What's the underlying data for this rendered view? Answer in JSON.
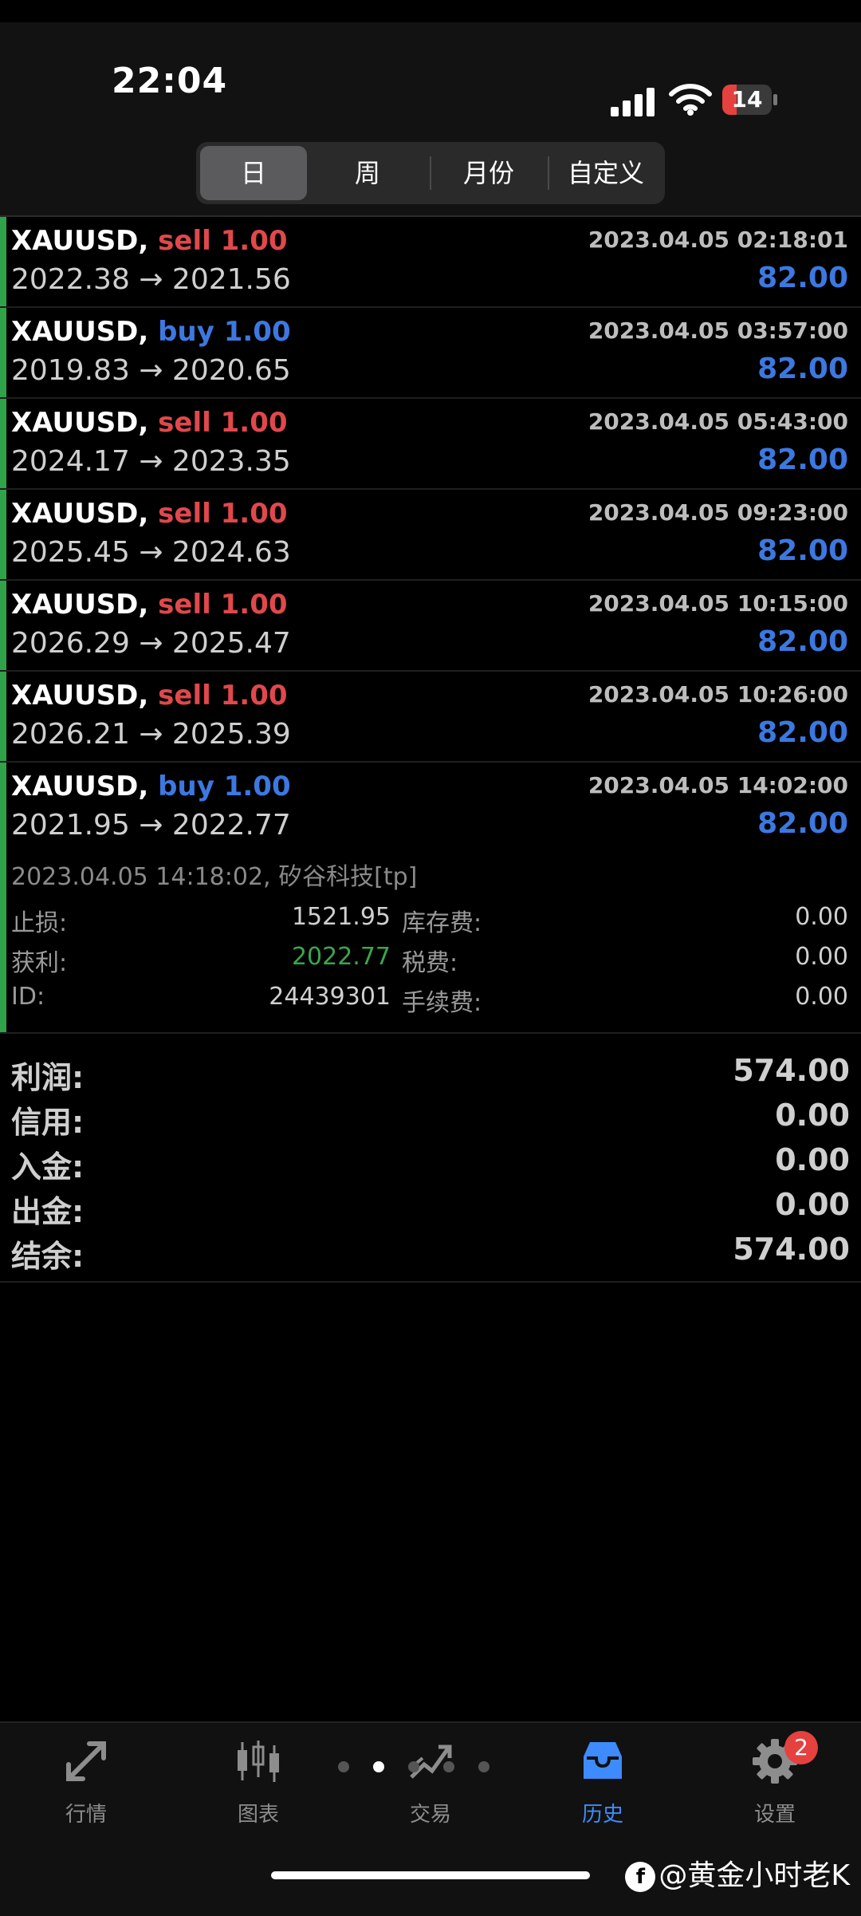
{
  "status_bar": {
    "time": "22:04",
    "battery": "14"
  },
  "period_tabs": [
    "日",
    "周",
    "月份",
    "自定义"
  ],
  "deals": [
    {
      "symbol": "XAUUSD,",
      "type": "sell",
      "volume": "1.00",
      "time": "2023.04.05 02:18:01",
      "prices": "2022.38 → 2021.56",
      "profit": "82.00"
    },
    {
      "symbol": "XAUUSD,",
      "type": "buy",
      "volume": "1.00",
      "time": "2023.04.05 03:57:00",
      "prices": "2019.83 → 2020.65",
      "profit": "82.00"
    },
    {
      "symbol": "XAUUSD,",
      "type": "sell",
      "volume": "1.00",
      "time": "2023.04.05 05:43:00",
      "prices": "2024.17 → 2023.35",
      "profit": "82.00"
    },
    {
      "symbol": "XAUUSD,",
      "type": "sell",
      "volume": "1.00",
      "time": "2023.04.05 09:23:00",
      "prices": "2025.45 → 2024.63",
      "profit": "82.00"
    },
    {
      "symbol": "XAUUSD,",
      "type": "sell",
      "volume": "1.00",
      "time": "2023.04.05 10:15:00",
      "prices": "2026.29 → 2025.47",
      "profit": "82.00"
    },
    {
      "symbol": "XAUUSD,",
      "type": "sell",
      "volume": "1.00",
      "time": "2023.04.05 10:26:00",
      "prices": "2026.21 → 2025.39",
      "profit": "82.00"
    },
    {
      "symbol": "XAUUSD,",
      "type": "buy",
      "volume": "1.00",
      "time": "2023.04.05 14:02:00",
      "prices": "2021.95 → 2022.77",
      "profit": "82.00"
    }
  ],
  "detail": {
    "comment": "2023.04.05 14:18:02, 矽谷科技[tp]",
    "stop_loss_label": "止损:",
    "stop_loss": "1521.95",
    "swap_label": "库存费:",
    "swap": "0.00",
    "take_profit_label": "获利:",
    "take_profit": "2022.77",
    "taxes_label": "税费:",
    "taxes": "0.00",
    "id_label": "ID:",
    "id": "24439301",
    "commission_label": "手续费:",
    "commission": "0.00"
  },
  "totals": [
    {
      "label": "利润:",
      "value": "574.00"
    },
    {
      "label": "信用:",
      "value": "0.00"
    },
    {
      "label": "入金:",
      "value": "0.00"
    },
    {
      "label": "出金:",
      "value": "0.00"
    },
    {
      "label": "结余:",
      "value": "574.00"
    }
  ],
  "tabbar": {
    "tabs": [
      {
        "label": "行情",
        "icon": "quotes-arrows-icon"
      },
      {
        "label": "图表",
        "icon": "candlestick-chart-icon"
      },
      {
        "label": "交易",
        "icon": "trade-chart-icon"
      },
      {
        "label": "历史",
        "icon": "history-inbox-icon"
      },
      {
        "label": "设置",
        "icon": "gear-icon"
      }
    ],
    "settings_badge": "2"
  },
  "watermark": "@黄金小时老K",
  "colors": {
    "sell": "#e0484c",
    "buy": "#3c78e0",
    "profit": "#3c78e0",
    "active_tab": "#3d8bfd",
    "green": "#3aa64c"
  }
}
